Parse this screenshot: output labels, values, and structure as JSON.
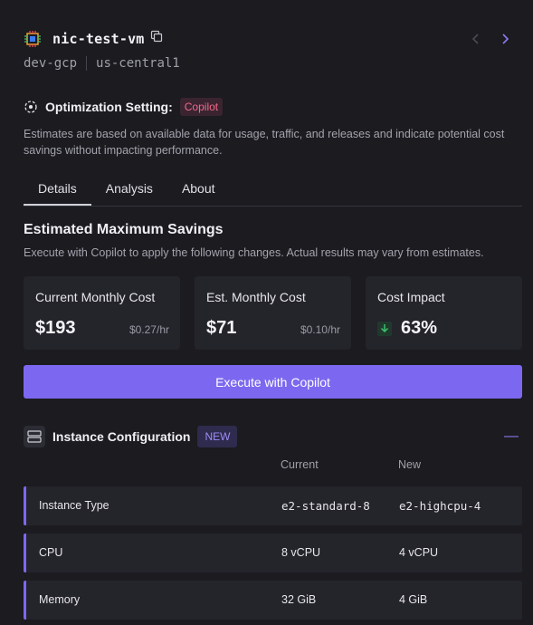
{
  "header": {
    "vm_name": "nic-test-vm",
    "project": "dev-gcp",
    "region": "us-central1",
    "prev_icon": "chevron-left-icon",
    "next_icon": "chevron-right-icon"
  },
  "optimization": {
    "label": "Optimization Setting:",
    "mode": "Copilot",
    "description": "Estimates are based on available data for usage, traffic, and releases and indicate potential cost savings without impacting performance."
  },
  "tabs": [
    {
      "label": "Details",
      "active": true
    },
    {
      "label": "Analysis",
      "active": false
    },
    {
      "label": "About",
      "active": false
    }
  ],
  "savings": {
    "title": "Estimated Maximum Savings",
    "description": "Execute with Copilot to apply the following changes. Actual results may vary from estimates.",
    "cards": {
      "current": {
        "label": "Current Monthly Cost",
        "value": "$193",
        "rate": "$0.27/hr"
      },
      "estimated": {
        "label": "Est. Monthly Cost",
        "value": "$71",
        "rate": "$0.10/hr"
      },
      "impact": {
        "label": "Cost Impact",
        "value": "63%"
      }
    },
    "execute_label": "Execute with Copilot"
  },
  "instance_config": {
    "title": "Instance Configuration",
    "badge": "NEW",
    "collapse_symbol": "—",
    "columns": {
      "current": "Current",
      "new": "New"
    },
    "rows": [
      {
        "label": "Instance Type",
        "current": "e2-standard-8",
        "new": "e2-highcpu-4",
        "mono": true
      },
      {
        "label": "CPU",
        "current": "8 vCPU",
        "new": "4 vCPU",
        "mono": false
      },
      {
        "label": "Memory",
        "current": "32 GiB",
        "new": "4 GiB",
        "mono": false
      }
    ]
  },
  "colors": {
    "accent": "#7c68f0",
    "background": "#1b1b20",
    "card": "#24242b",
    "copilot_badge_text": "#f06a8a",
    "positive": "#3fbf6f"
  }
}
